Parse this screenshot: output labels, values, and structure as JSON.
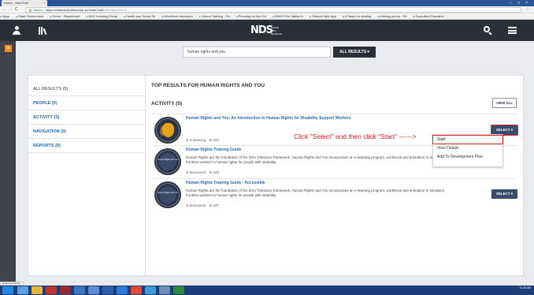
{
  "browser": {
    "tab_title": "Home - SumTotal",
    "tab_close": "×",
    "url_secure": "Secure",
    "url_host": "https://ndslearnanddevelop.sumtotal.host",
    "url_path": "/core/dash/home",
    "bookmarks": [
      "Apps",
      "State Government",
      "Home – Blackboard",
      "NDS Learning Portal",
      "Health and Social Se",
      "Workforce developm",
      "Onbus Training - On",
      "Planning for the Fut",
      "DHHS Fire Safety In",
      "Outlook Web App",
      "8 Steps for dealing",
      "training.gov.au - Pri",
      "Executive Education"
    ]
  },
  "header": {
    "logo_text": "NDS",
    "logo_sub": "LEARN AND DEVELOP",
    "menu_icon": "hamburger-menu-icon",
    "search_icon": "search-icon",
    "user_icon": "user-icon",
    "library_icon": "library-icon"
  },
  "rail": {
    "close_label": "×"
  },
  "search": {
    "value": "human rights and you",
    "scope_label": "ALL RESULTS ▾"
  },
  "sidebar": {
    "items": [
      {
        "label": "ALL RESULTS (5)"
      },
      {
        "label": "PEOPLE (0)"
      },
      {
        "label": "ACTIVITY (5)"
      },
      {
        "label": "NAVIGATION (0)"
      },
      {
        "label": "REPORTS (0)"
      }
    ]
  },
  "main": {
    "title": "TOP RESULTS FOR HUMAN RIGHTS AND YOU",
    "section_title": "ACTIVITY (5)",
    "view_all_label": "VIEW ALL",
    "cards": [
      {
        "title": "Human Rights and You: An Introduction to Human Rights for Disability Support Workers",
        "type": "E-learning",
        "id": "224",
        "select_label": "SELECT ▾"
      },
      {
        "title": "Human Rights Training Guide",
        "description": "Human Rights are the foundation of the Zero Tolerance framework. Human Rights and You incorporates an e-learning program, workbook and animation to introduce frontline workers to human rights for people with disability.",
        "type": "Document",
        "id": "228",
        "thumb_text": "Human Rights and You"
      },
      {
        "title": "Human Rights Training Guide - Accessible",
        "description": "Human Rights are the foundation of the Zero Tolerance framework. Human Rights and You incorporates an e-learning program, workbook and animation to introduce frontline workers to human rights for people with disability.",
        "type": "Document",
        "id": "227",
        "select_label": "SELECT ▾",
        "thumb_text": "Human Rights and You"
      }
    ],
    "dropdown": [
      "Start",
      "View Details",
      "Add To Development Plan"
    ]
  },
  "annotation": "Click \"Select\" and then click \"Start\" ------>",
  "status": {
    "tip": "javascript:void(0);"
  },
  "taskbar": {
    "time": "11:49 AM"
  }
}
